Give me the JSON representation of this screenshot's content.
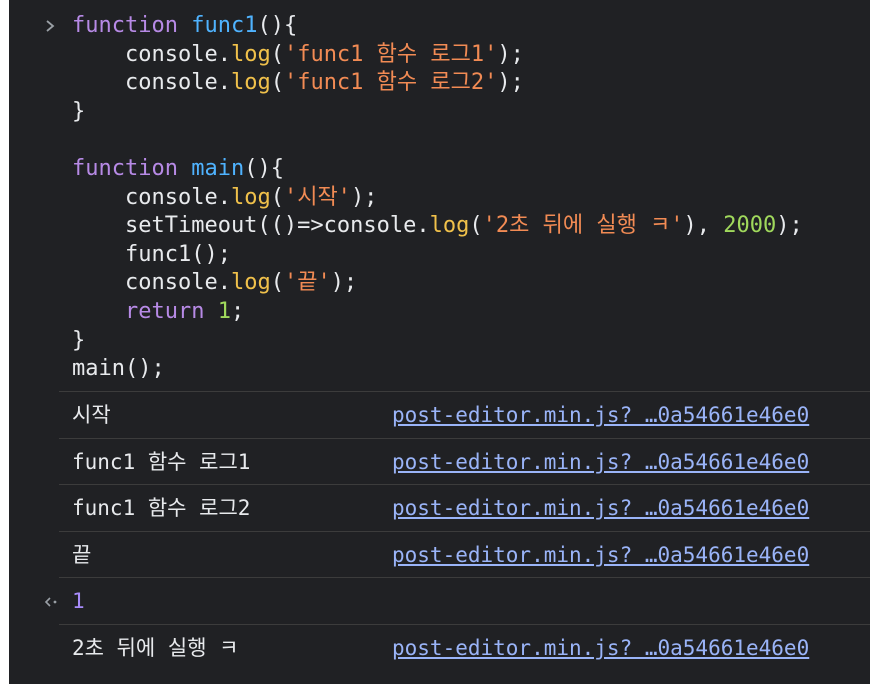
{
  "input": {
    "prompt_icon": "chevron-right",
    "lines": [
      [
        {
          "t": "function",
          "c": "kw"
        },
        {
          "t": " ",
          "c": "obj"
        },
        {
          "t": "func1",
          "c": "fn"
        },
        {
          "t": "(){",
          "c": "obj"
        }
      ],
      [
        {
          "t": "    console.",
          "c": "obj"
        },
        {
          "t": "log",
          "c": "meth"
        },
        {
          "t": "(",
          "c": "obj"
        },
        {
          "t": "'func1 함수 로그1'",
          "c": "str"
        },
        {
          "t": ");",
          "c": "obj"
        }
      ],
      [
        {
          "t": "    console.",
          "c": "obj"
        },
        {
          "t": "log",
          "c": "meth"
        },
        {
          "t": "(",
          "c": "obj"
        },
        {
          "t": "'func1 함수 로그2'",
          "c": "str"
        },
        {
          "t": ");",
          "c": "obj"
        }
      ],
      [
        {
          "t": "}",
          "c": "obj"
        }
      ],
      [
        {
          "t": "",
          "c": "obj"
        }
      ],
      [
        {
          "t": "function",
          "c": "kw"
        },
        {
          "t": " ",
          "c": "obj"
        },
        {
          "t": "main",
          "c": "fn"
        },
        {
          "t": "(){",
          "c": "obj"
        }
      ],
      [
        {
          "t": "    console.",
          "c": "obj"
        },
        {
          "t": "log",
          "c": "meth"
        },
        {
          "t": "(",
          "c": "obj"
        },
        {
          "t": "'시작'",
          "c": "str"
        },
        {
          "t": ");",
          "c": "obj"
        }
      ],
      [
        {
          "t": "    setTimeout(()=>console.",
          "c": "obj"
        },
        {
          "t": "log",
          "c": "meth"
        },
        {
          "t": "(",
          "c": "obj"
        },
        {
          "t": "'2초 뒤에 실행 ㅋ'",
          "c": "str"
        },
        {
          "t": "), ",
          "c": "obj"
        },
        {
          "t": "2000",
          "c": "num"
        },
        {
          "t": ");",
          "c": "obj"
        }
      ],
      [
        {
          "t": "    func1();",
          "c": "obj"
        }
      ],
      [
        {
          "t": "    console.",
          "c": "obj"
        },
        {
          "t": "log",
          "c": "meth"
        },
        {
          "t": "(",
          "c": "obj"
        },
        {
          "t": "'끝'",
          "c": "str"
        },
        {
          "t": ");",
          "c": "obj"
        }
      ],
      [
        {
          "t": "    ",
          "c": "obj"
        },
        {
          "t": "return",
          "c": "kw"
        },
        {
          "t": " ",
          "c": "obj"
        },
        {
          "t": "1",
          "c": "num"
        },
        {
          "t": ";",
          "c": "obj"
        }
      ],
      [
        {
          "t": "}",
          "c": "obj"
        }
      ],
      [
        {
          "t": "main();",
          "c": "obj"
        }
      ]
    ]
  },
  "logs": [
    {
      "text": "시작",
      "source": "post-editor.min.js? …0a54661e46e0"
    },
    {
      "text": "func1 함수 로그1",
      "source": "post-editor.min.js? …0a54661e46e0"
    },
    {
      "text": "func1 함수 로그2",
      "source": "post-editor.min.js? …0a54661e46e0"
    },
    {
      "text": "끝",
      "source": "post-editor.min.js? …0a54661e46e0"
    }
  ],
  "result": {
    "icon": "return-arrow-icon",
    "value": "1"
  },
  "late_log": {
    "text": "2초 뒤에 실행 ㅋ",
    "source": "post-editor.min.js? …0a54661e46e0"
  }
}
